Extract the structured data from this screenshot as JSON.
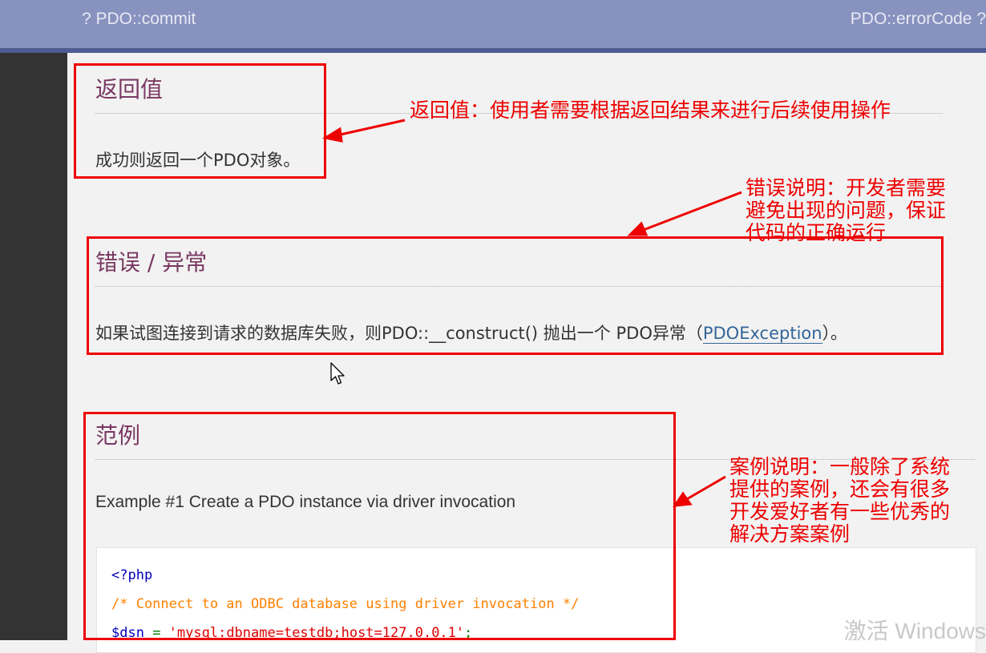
{
  "nav": {
    "prev_label": "? PDO::commit",
    "next_label": "PDO::errorCode ?"
  },
  "sections": {
    "return_value": {
      "title": "返回值",
      "text": "成功则返回一个PDO对象。"
    },
    "errors": {
      "title": "错误 / 异常",
      "text_before": "如果试图连接到请求的数据库失败，则PDO::__construct() 抛出一个 PDO异常（",
      "link": "PDOException",
      "text_after": "）。"
    },
    "examples": {
      "title": "范例",
      "example_title": "Example #1 Create a PDO instance via driver invocation",
      "code": {
        "line1": "<?php",
        "line2": "/* Connect to an ODBC database using driver invocation */",
        "line3_var": "$dsn",
        "line3_op": " = ",
        "line3_str": "'mysql:dbname=testdb;host=127.0.0.1'",
        "line3_end": ";"
      }
    }
  },
  "annotations": {
    "return_value": "返回值：使用者需要根据返回结果来进行后续使用操作",
    "errors_line1": "错误说明：开发者需要",
    "errors_line2": "避免出现的问题，保证",
    "errors_line3": "代码的正确运行",
    "examples_line1": "案例说明：一般除了系统",
    "examples_line2": "提供的案例，还会有很多",
    "examples_line3": "开发爱好者有一些优秀的",
    "examples_line4": "解决方案案例"
  },
  "watermark": "激活 Windows",
  "colors": {
    "header_bg": "#8892bf",
    "header_border": "#4f5b93",
    "title": "#793862",
    "annotation_red": "#ee0000",
    "link": "#336699"
  }
}
